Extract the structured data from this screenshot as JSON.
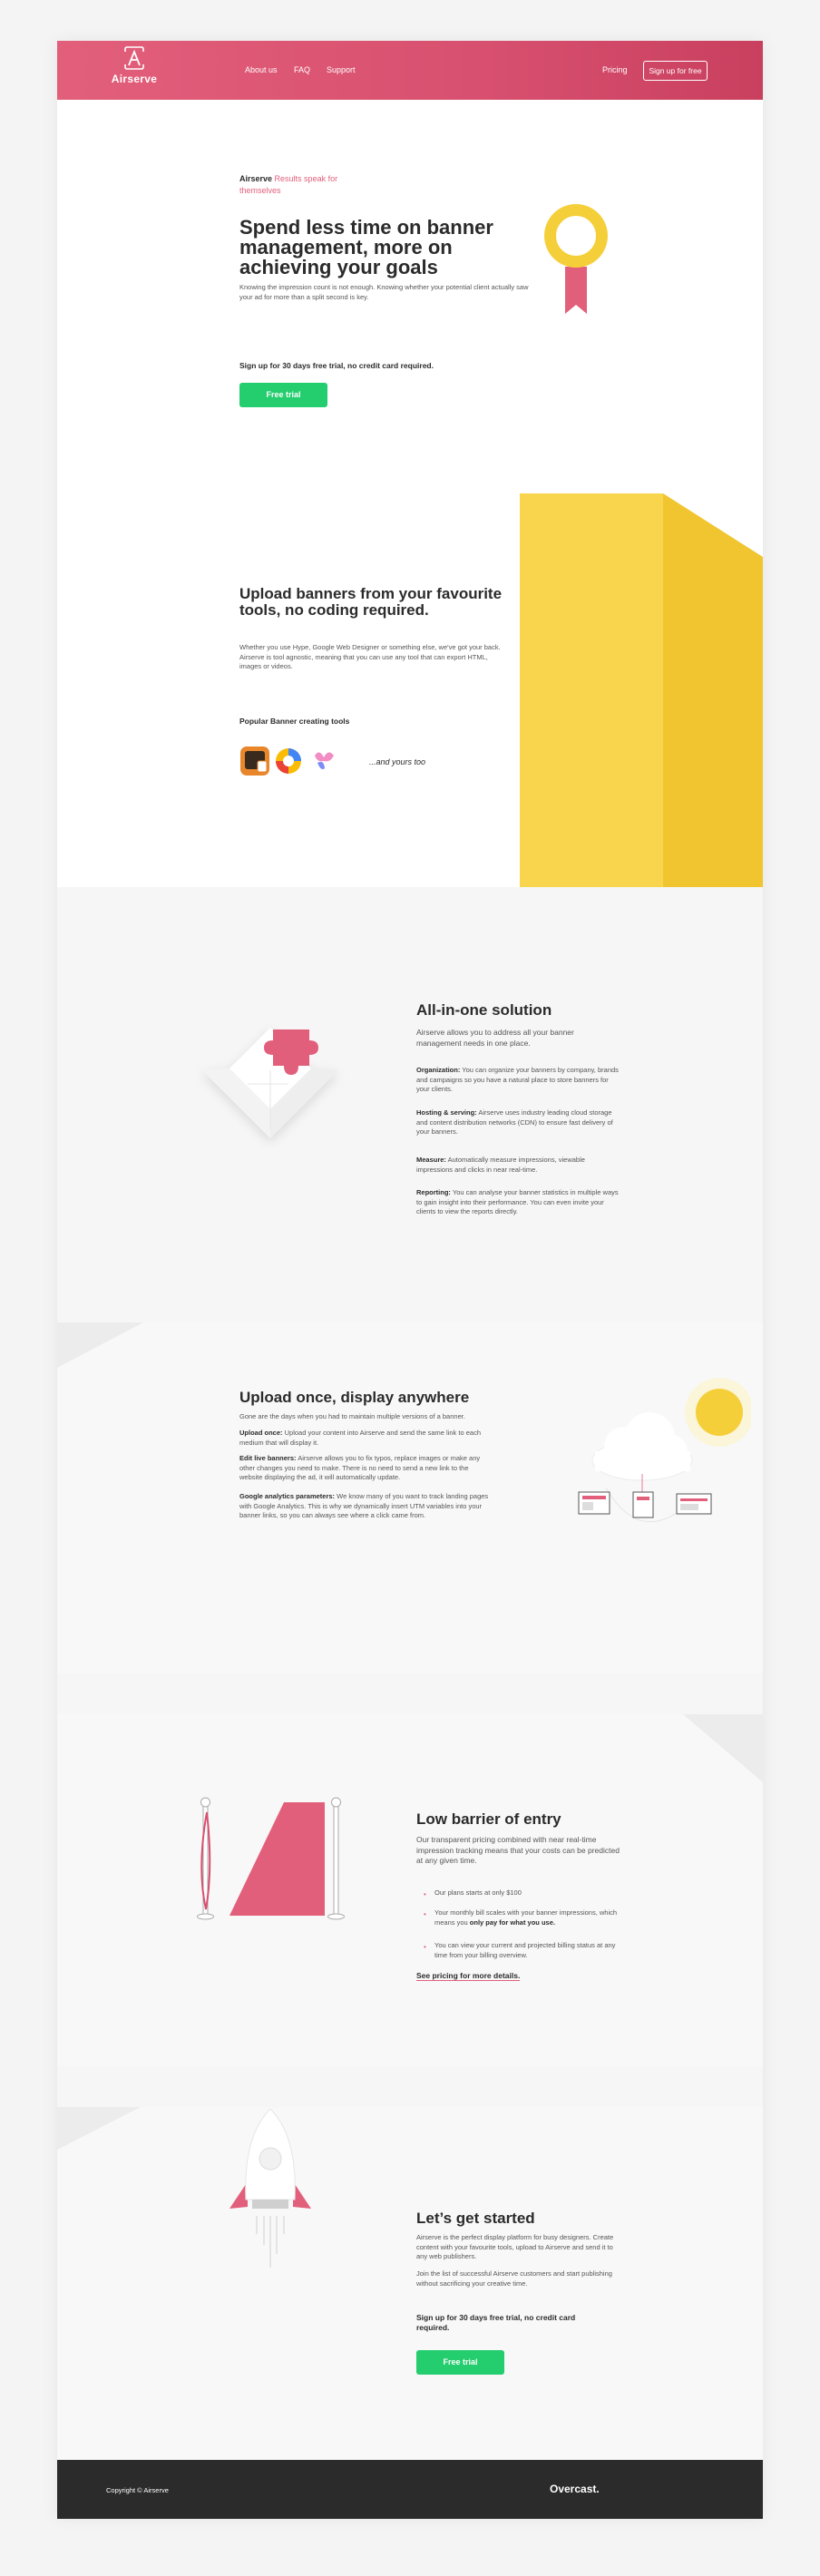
{
  "header": {
    "brand": "Airserve",
    "nav": [
      "About us",
      "FAQ",
      "Support"
    ],
    "pricing": "Pricing",
    "signup": "Sign up for free"
  },
  "hero": {
    "eyebrow_brand": "Airserve",
    "eyebrow_tagline": "Results speak for themselves",
    "title": "Spend less time on banner management, more on achieving your goals",
    "body": "Knowing the impression count is not enough. Knowing whether your potential client actually saw your ad for more than a split second is key.",
    "note": "Sign up for 30 days free trial, no credit card required.",
    "cta": "Free trial"
  },
  "upload": {
    "title": "Upload banners from your favourite tools, no coding required.",
    "body": "Whether you use Hype, Google Web Designer or something else, we've got your back. Airserve is tool agnostic, meaning that you can use any tool that can export HTML, images or videos.",
    "tools_title": "Popular Banner creating tools",
    "tools_suffix": "...and yours too"
  },
  "allinone": {
    "title": "All-in-one solution",
    "intro": "Airserve allows you to address all your banner management needs in one place.",
    "items": [
      {
        "label": "Organization:",
        "text": "You can organize your banners by company, brands and campaigns so you have a natural place to store banners for your clients."
      },
      {
        "label": "Hosting & serving:",
        "text": "Airserve uses industry leading cloud storage and content distribution networks (CDN) to ensure fast delivery of your banners."
      },
      {
        "label": "Measure:",
        "text": "Automatically measure impressions, viewable impressions and clicks in near real-time."
      },
      {
        "label": "Reporting:",
        "text": "You can analyse your banner statistics in multiple ways to gain insight into their performance. You can even invite your clients to view the reports directly."
      }
    ]
  },
  "uploadonce": {
    "title": "Upload once, display anywhere",
    "intro": "Gone are the days when you had to maintain multiple versions of a banner.",
    "items": [
      {
        "label": "Upload once:",
        "text": "Upload your content into Airserve and send the same link to each medium that will display it."
      },
      {
        "label": "Edit live banners:",
        "text": "Airserve allows you to fix typos, replace images or make any other changes you need to make. There is no need to send a new link to the website displaying the ad, it will automatically update."
      },
      {
        "label": "Google analytics parameters:",
        "text": "We know many of you want to track landing pages with Google Analytics. This is why we dynamically insert UTM variables into your banner links, so you can always see where a click came from."
      }
    ]
  },
  "barrier": {
    "title": "Low barrier of entry",
    "intro": "Our transparent pricing combined with near real-time impression tracking means that your costs can be predicted at any given time.",
    "bullets": [
      {
        "text": "Our plans starts at only $100",
        "bold": ""
      },
      {
        "text": "Your monthly bill scales with your banner impressions, which means you ",
        "bold": "only pay for what you use."
      },
      {
        "text": "You can view your current and projected billing status at any time from your billing overview.",
        "bold": ""
      }
    ],
    "link": "See pricing for more details."
  },
  "started": {
    "title": "Let’s get started",
    "p1": "Airserve is the perfect display platform for busy designers. Create content with your favourite tools, upload to Airserve and send it to any web publishers.",
    "p2": "Join the list of successful Airserve customers and start publishing without sacrificing your creative time.",
    "note": "Sign up for 30 days free trial, no credit card required.",
    "cta": "Free trial"
  },
  "footer": {
    "copyright": "Copyright © Airserve",
    "brand": "Overcast."
  },
  "colors": {
    "accent": "#e25f7b",
    "green": "#24cd6e",
    "yellow": "#f5cf3a",
    "dark": "#2b2b2b"
  },
  "icons": [
    "airserve-logo-icon",
    "award-ribbon-icon",
    "hype-app-icon",
    "google-web-designer-icon",
    "butterfly-tool-icon",
    "puzzle-icon",
    "cloud-icon",
    "sun-icon",
    "rope-barrier-icon",
    "rocket-icon"
  ]
}
